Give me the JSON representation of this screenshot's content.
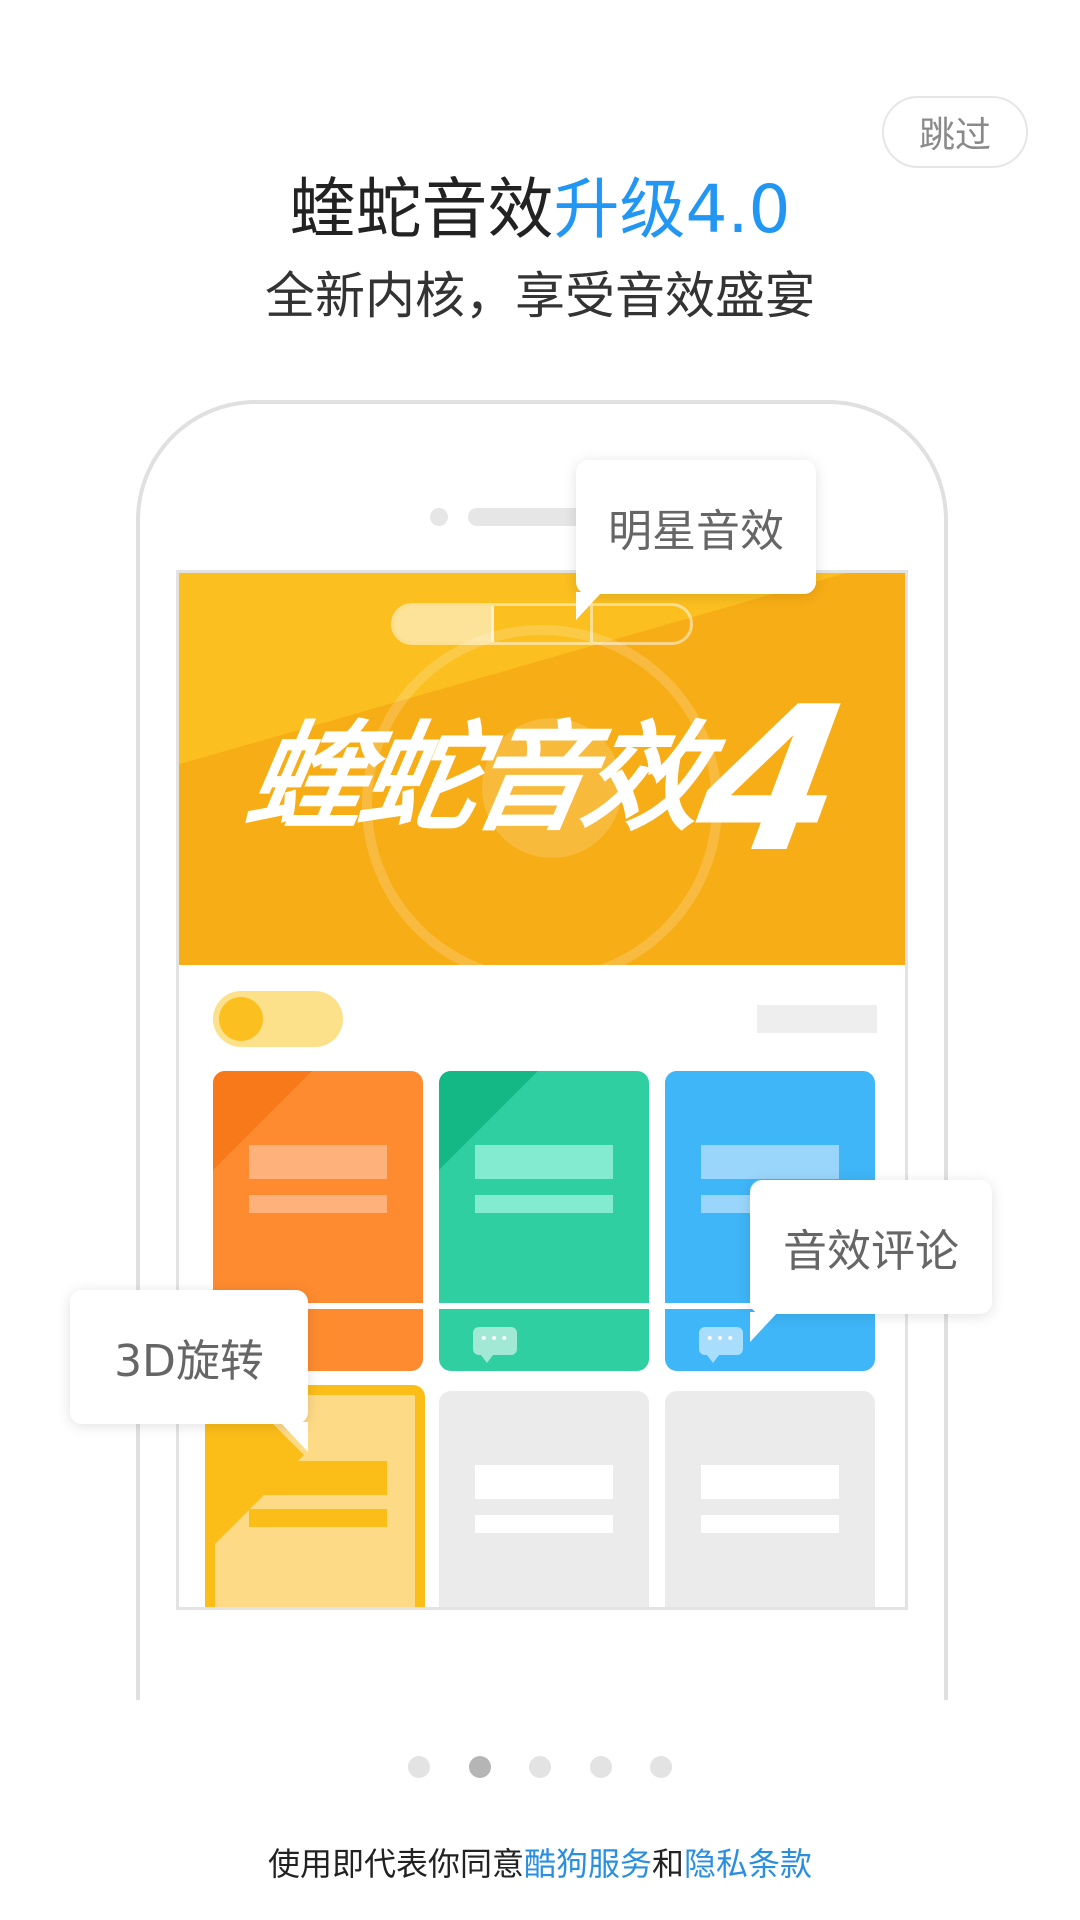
{
  "header": {
    "skip_label": "跳过",
    "title_main": "蝰蛇音效",
    "title_accent": "升级4.0",
    "subtitle": "全新内核，享受音效盛宴"
  },
  "colors": {
    "accent": "#2196f3",
    "link": "#2a8fe0",
    "banner": "#fbbf1f",
    "card_orange": "#fe8b2f",
    "card_green": "#2fcfa1",
    "card_blue": "#3fb6f8",
    "card_yellow": "#fddb86"
  },
  "illustration": {
    "banner_logo": "蝰蛇音效",
    "banner_logo_number": "4",
    "chat_icon": "chat-bubble-icon",
    "tooltips": {
      "star_effects": "明星音效",
      "effect_comments": "音效评论",
      "rotate_3d": "3D旋转"
    }
  },
  "pager": {
    "count": 5,
    "active_index": 1
  },
  "footer": {
    "prefix": "使用即代表你同意",
    "service_link": "酷狗服务",
    "connector": "和",
    "privacy_link": "隐私条款"
  }
}
